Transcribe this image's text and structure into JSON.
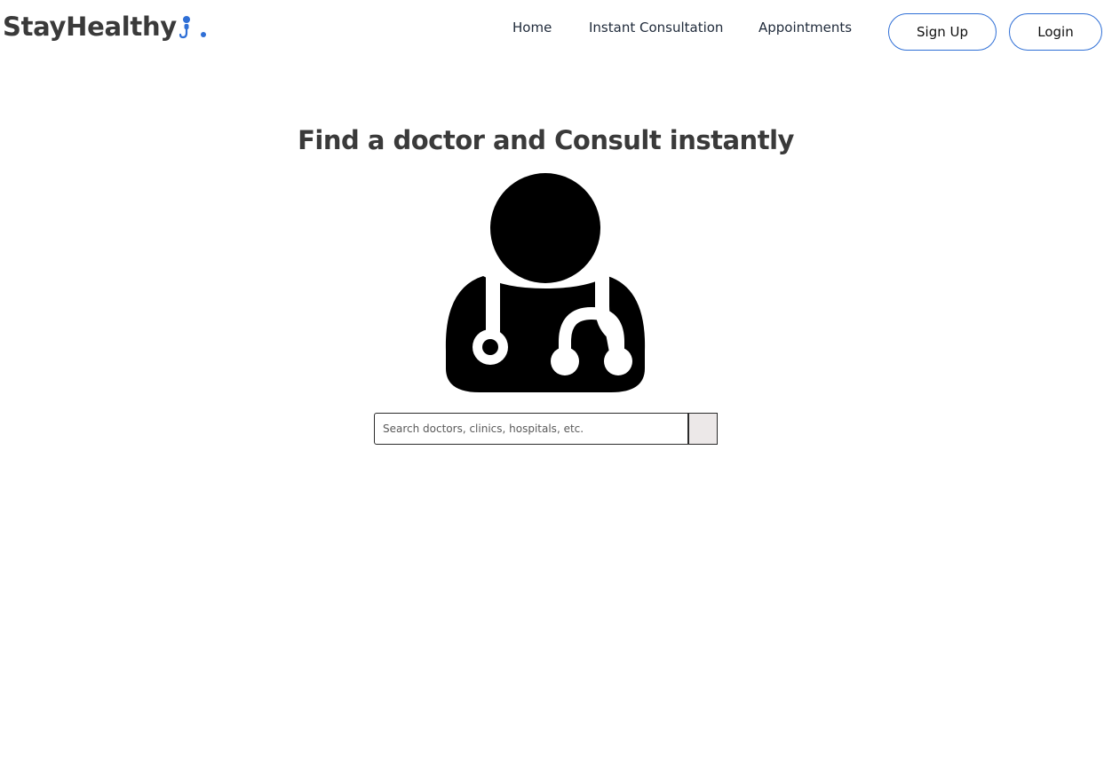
{
  "brand": {
    "name": "StayHealthy",
    "accent_color": "#2f6fd6",
    "icon": "person-with-stethoscope-icon"
  },
  "nav": {
    "links": [
      "Home",
      "Instant Consultation",
      "Appointments"
    ],
    "signup_label": "Sign Up",
    "login_label": "Login"
  },
  "hero": {
    "title": "Find a doctor and Consult instantly",
    "illustration": "doctor-icon"
  },
  "search": {
    "placeholder": "Search doctors, clinics, hospitals, etc.",
    "value": "",
    "button_icon": "search-button"
  },
  "colors": {
    "text_dark": "#3a3a3a",
    "button_border": "#2f6fd6",
    "search_button_bg": "#ece8e8"
  }
}
